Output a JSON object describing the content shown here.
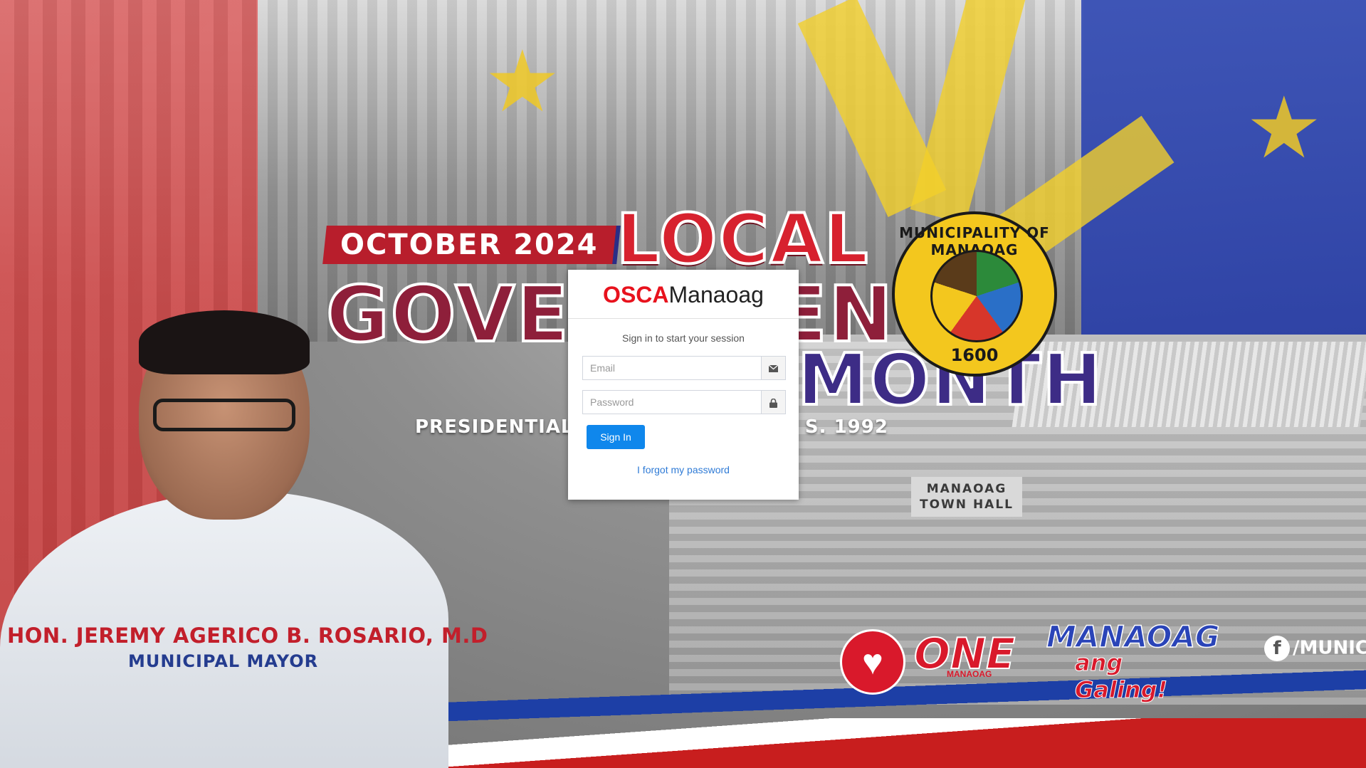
{
  "banner": {
    "month_label": "OCTOBER 2024",
    "title_line1": "LOCAL",
    "title_line2": "GOVERNMENT",
    "title_line3": "MONTH",
    "proclamation_left": "PRESIDENTIAL",
    "proclamation_right": ", S. 1992",
    "seal_text": "MUNICIPALITY OF MANAOAG",
    "seal_year": "1600",
    "townhall_line1": "MANAOAG",
    "townhall_line2": "TOWN HALL",
    "mayor_name": "HON. JEREMY AGERICO B. ROSARIO, M.D",
    "mayor_title": "MUNICIPAL MAYOR",
    "logo_one": "ONE",
    "logo_one_sub": "MANAOAG",
    "logo_galing": "MANAOAG",
    "logo_galing_sub": "ang Galing!",
    "facebook_handle": "/MUNICI",
    "colors": {
      "red": "#c21f2b",
      "blue": "#243c8f",
      "yellow": "#f3c71e"
    }
  },
  "login": {
    "logo_bold": "OSCA",
    "logo_regular": "Manaoag",
    "message": "Sign in to start your session",
    "email_placeholder": "Email",
    "email_value": "",
    "email_icon": "envelope-icon",
    "password_placeholder": "Password",
    "password_value": "",
    "password_icon": "lock-icon",
    "signin_label": "Sign In",
    "forgot_label": "I forgot my password",
    "accent_color": "#0f87ec",
    "brand_color": "#e8121d"
  }
}
